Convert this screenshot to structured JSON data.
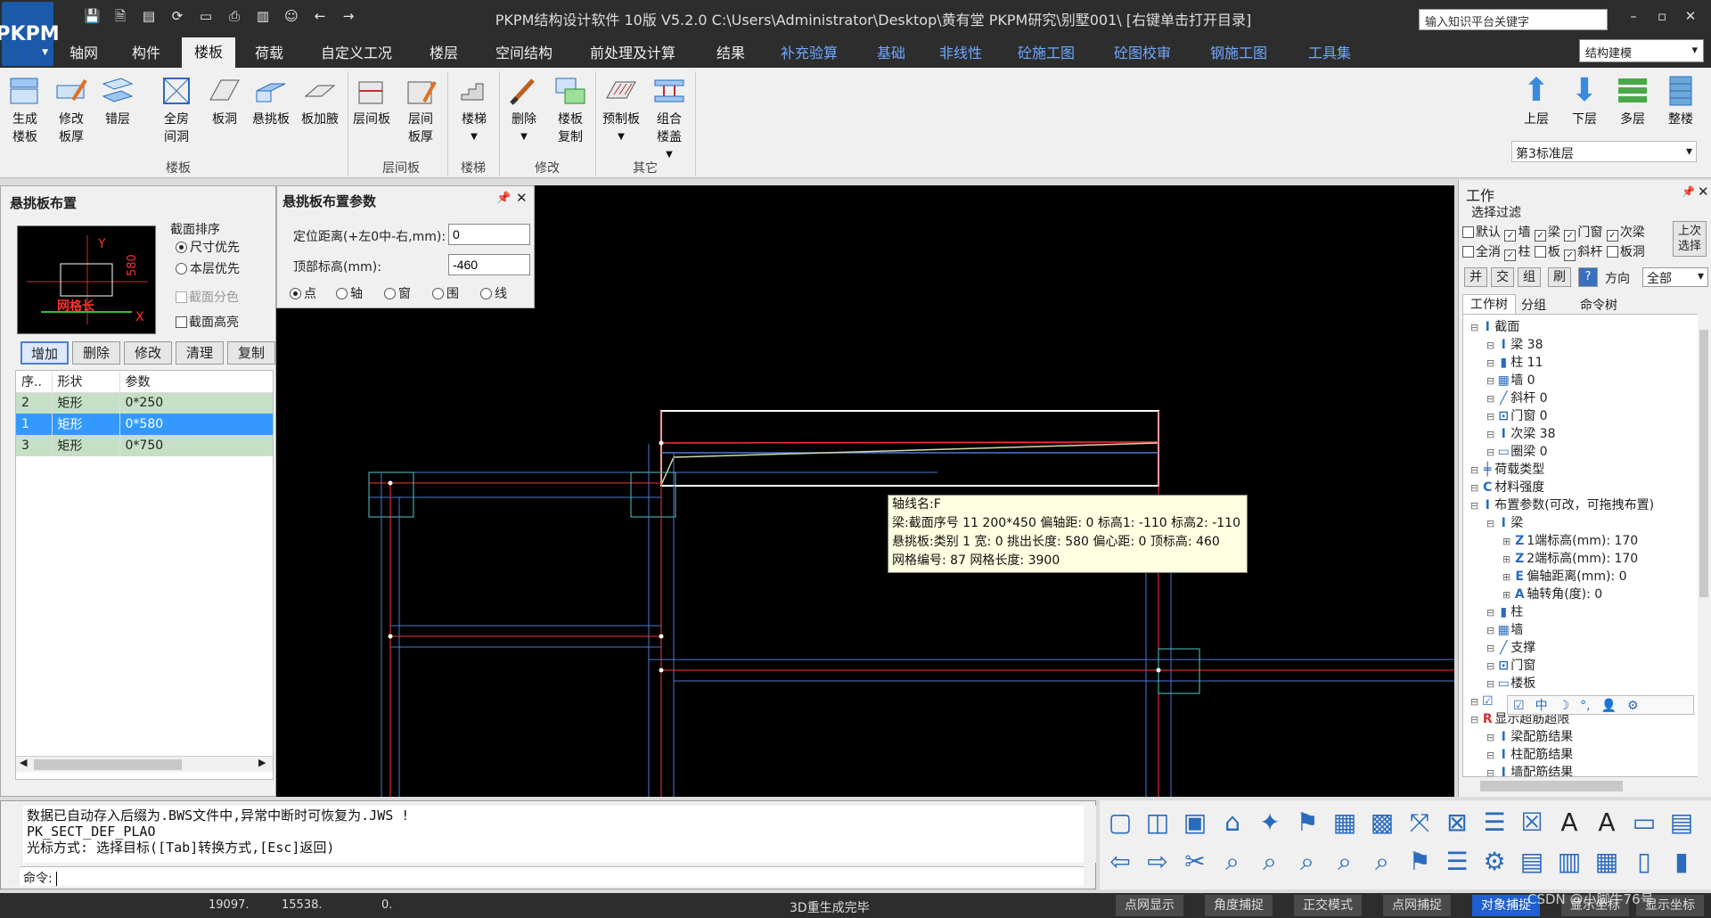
{
  "app": {
    "title": "PKPM结构设计软件 10版 V5.2.0 C:\\Users\\Administrator\\Desktop\\黄有堂 PKPM研究\\别墅001\\  [右键单击打开目录]",
    "logo": "PKPM",
    "search_placeholder": "输入知识平台关键字",
    "win_min": "–",
    "win_max": "▫",
    "win_close": "✕"
  },
  "menu": {
    "tabs": [
      "轴网",
      "构件",
      "楼板",
      "荷载",
      "自定义工况",
      "楼层",
      "空间结构",
      "前处理及计算",
      "结果",
      "补充验算",
      "基础",
      "非线性",
      "砼施工图",
      "砼图校审",
      "钢施工图",
      "工具集"
    ],
    "active": "楼板",
    "mode": "结构建模"
  },
  "ribbon": {
    "buttons": [
      {
        "label": "生成\n楼板"
      },
      {
        "label": "修改\n板厚"
      },
      {
        "label": "错层"
      },
      {
        "label": "全房\n间洞"
      },
      {
        "label": "板洞"
      },
      {
        "label": "悬挑板"
      },
      {
        "label": "板加腋"
      },
      {
        "label": "层间板"
      },
      {
        "label": "层间\n板厚"
      },
      {
        "label": "楼梯"
      },
      {
        "label": "删除"
      },
      {
        "label": "楼板\n复制"
      },
      {
        "label": "预制板"
      },
      {
        "label": "组合\n楼盖"
      }
    ],
    "groups": [
      "楼板",
      "层间板",
      "楼梯",
      "修改",
      "其它"
    ],
    "floor_buttons": [
      "上层",
      "下层",
      "多层",
      "整楼"
    ],
    "floor": "第3标准层"
  },
  "left_panel": {
    "title": "悬挑板布置",
    "preview_labels": {
      "y": "Y",
      "x": "X",
      "height": "580",
      "length": "网格长"
    },
    "sort_title": "截面排序",
    "sort_options": [
      "尺寸优先",
      "本层优先"
    ],
    "section_color": "截面分色",
    "section_height": "截面高亮",
    "buttons": [
      "增加",
      "删除",
      "修改",
      "清理",
      "复制"
    ],
    "columns": [
      "序..",
      "形状",
      "参数"
    ],
    "rows": [
      {
        "no": "2",
        "shape": "矩形",
        "param": "0*250"
      },
      {
        "no": "1",
        "shape": "矩形",
        "param": "0*580"
      },
      {
        "no": "3",
        "shape": "矩形",
        "param": "0*750"
      }
    ]
  },
  "param_dialog": {
    "title": "悬挑板布置参数",
    "offset_label": "定位距离(+左0中-右,mm):",
    "offset_value": "0",
    "top_label": "顶部标高(mm):",
    "top_value": "-460",
    "modes": [
      "点",
      "轴",
      "窗",
      "围",
      "线"
    ]
  },
  "tooltip": {
    "line1": "轴线名:F",
    "line2": "梁:截面序号 11 200*450 偏轴距: 0 标高1: -110 标高2: -110",
    "line3": "悬挑板:类别 1 宽: 0 挑出长度: 580 偏心距: 0 顶标高: 460",
    "line4": "网格编号: 87 网格长度: 3900"
  },
  "right_panel": {
    "title": "工作",
    "filter_title": "选择过滤",
    "filters_row1": [
      {
        "l": "默认",
        "c": false
      },
      {
        "l": "墙",
        "c": true
      },
      {
        "l": "梁",
        "c": true
      },
      {
        "l": "门窗",
        "c": true
      },
      {
        "l": "次梁",
        "c": true
      }
    ],
    "filters_row2": [
      {
        "l": "全消",
        "c": false
      },
      {
        "l": "柱",
        "c": true
      },
      {
        "l": "板",
        "c": false
      },
      {
        "l": "斜杆",
        "c": true
      },
      {
        "l": "板洞",
        "c": false
      }
    ],
    "last_select": "上次\n选择",
    "tool_buttons": [
      "并",
      "交",
      "组",
      "刷",
      "?"
    ],
    "direction": "方向",
    "direction_value": "全部",
    "tabs": [
      "工作树",
      "分组",
      "命令树"
    ],
    "tree": [
      {
        "d": 0,
        "t": "截面"
      },
      {
        "d": 1,
        "t": "梁 38"
      },
      {
        "d": 1,
        "t": "柱 11"
      },
      {
        "d": 1,
        "t": "墙 0"
      },
      {
        "d": 1,
        "t": "斜杆 0"
      },
      {
        "d": 1,
        "t": "门窗 0"
      },
      {
        "d": 1,
        "t": "次梁 38"
      },
      {
        "d": 1,
        "t": "圈梁 0"
      },
      {
        "d": 0,
        "t": "荷载类型"
      },
      {
        "d": 0,
        "t": "材料强度"
      },
      {
        "d": 0,
        "t": "布置参数(可改，可拖拽布置)"
      },
      {
        "d": 1,
        "t": "梁"
      },
      {
        "d": 2,
        "t": "1端标高(mm):  170"
      },
      {
        "d": 2,
        "t": "2端标高(mm):  170"
      },
      {
        "d": 2,
        "t": "偏轴距离(mm):  0"
      },
      {
        "d": 2,
        "t": "轴转角(度):  0"
      },
      {
        "d": 1,
        "t": "柱"
      },
      {
        "d": 1,
        "t": "墙"
      },
      {
        "d": 1,
        "t": "支撑"
      },
      {
        "d": 1,
        "t": "门窗"
      },
      {
        "d": 1,
        "t": "楼板"
      },
      {
        "d": 0,
        "t": ""
      },
      {
        "d": 0,
        "t": "显示超筋超限"
      },
      {
        "d": 1,
        "t": "梁配筋结果"
      },
      {
        "d": 1,
        "t": "柱配筋结果"
      },
      {
        "d": 1,
        "t": "墙配筋结果"
      }
    ],
    "ime_bar": [
      "中",
      "☽",
      "°,",
      "👤",
      "⚙"
    ]
  },
  "command": {
    "lines": [
      "数据已自动存入后缀为.BWS文件中,异常中断时可恢复为.JWS !",
      "PK_SECT_DEF_PLAO",
      "光标方式: 选择目标([Tab]转换方式,[Esc]返回)"
    ],
    "prompt": "命令:"
  },
  "status": {
    "x": "19097.",
    "y": "15538.",
    "z": "0.",
    "message": "3D重生成完毕",
    "toggles": [
      "点网显示",
      "角度捕捉",
      "正交模式",
      "点网捕捉",
      "对象捕捉",
      "显示坐标",
      "显示坐标"
    ],
    "watermark": "CSDN @小脚牛76号"
  }
}
